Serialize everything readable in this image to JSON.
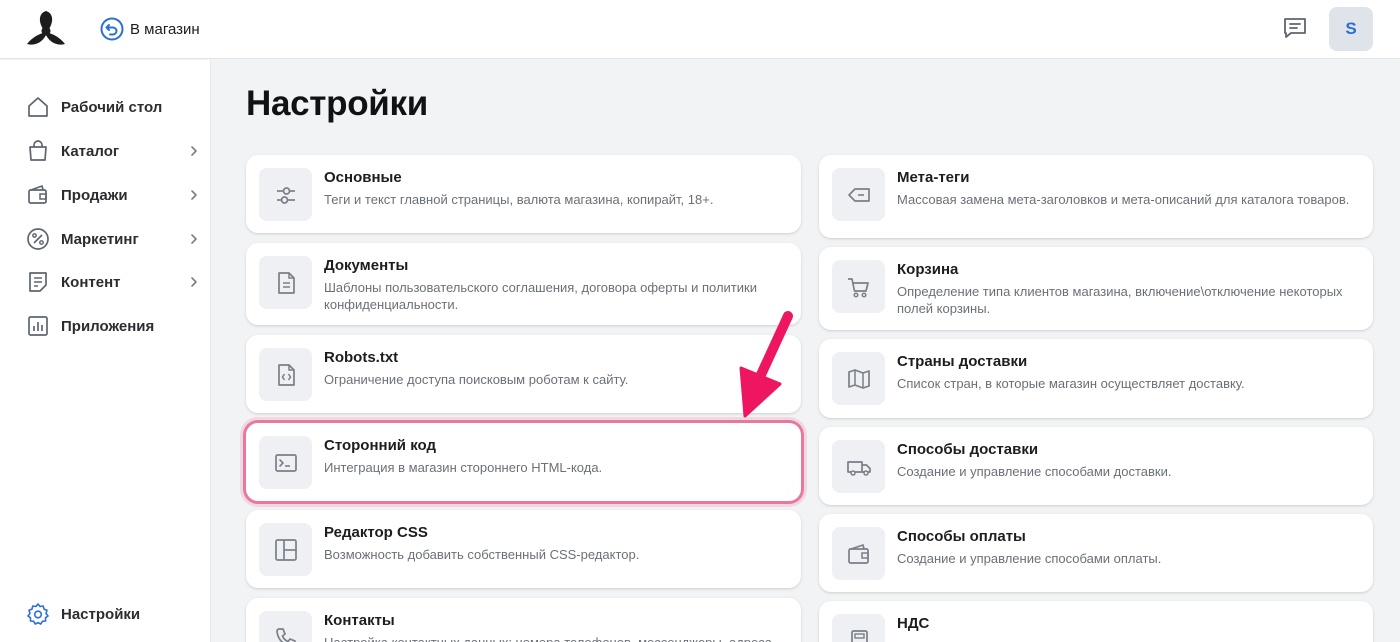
{
  "topbar": {
    "back_label": "В магазин",
    "avatar_letter": "S"
  },
  "sidebar": {
    "items": [
      {
        "label": "Рабочий стол",
        "icon": "home-icon",
        "has_submenu": false
      },
      {
        "label": "Каталог",
        "icon": "bag-icon",
        "has_submenu": true
      },
      {
        "label": "Продажи",
        "icon": "wallet-icon",
        "has_submenu": true
      },
      {
        "label": "Маркетинг",
        "icon": "percent-icon",
        "has_submenu": true
      },
      {
        "label": "Контент",
        "icon": "document-icon",
        "has_submenu": true
      },
      {
        "label": "Приложения",
        "icon": "apps-chart-icon",
        "has_submenu": false
      }
    ],
    "settings_label": "Настройки"
  },
  "main": {
    "title": "Настройки",
    "left_cards": [
      {
        "title": "Основные",
        "desc": "Теги и текст главной страницы, валюта магазина, копирайт, 18+.",
        "icon": "sliders-icon"
      },
      {
        "title": "Документы",
        "desc": "Шаблоны пользовательского соглашения, договора оферты и политики конфиденциальности.",
        "icon": "file-text-icon"
      },
      {
        "title": "Robots.txt",
        "desc": "Ограничение доступа поисковым роботам к сайту.",
        "icon": "file-code-icon"
      },
      {
        "title": "Сторонний код",
        "desc": "Интеграция в магазин стороннего HTML-кода.",
        "icon": "terminal-icon",
        "highlighted": true
      },
      {
        "title": "Редактор CSS",
        "desc": "Возможность добавить собственный CSS-редактор.",
        "icon": "layout-icon"
      },
      {
        "title": "Контакты",
        "desc": "Настройка контактных данных: номера телефонов, мессенджеры, адреса",
        "icon": "phone-icon"
      }
    ],
    "right_cards": [
      {
        "title": "Мета-теги",
        "desc": "Массовая замена мета-заголовков и мета-описаний для каталога товаров.",
        "icon": "tag-icon"
      },
      {
        "title": "Корзина",
        "desc": "Определение типа клиентов магазина, включение\\отключение некоторых полей корзины.",
        "icon": "cart-icon"
      },
      {
        "title": "Страны доставки",
        "desc": "Список стран, в которые магазин осуществляет доставку.",
        "icon": "map-icon"
      },
      {
        "title": "Способы доставки",
        "desc": "Создание и управление способами доставки.",
        "icon": "truck-icon"
      },
      {
        "title": "Способы оплаты",
        "desc": "Создание и управление способами оплаты.",
        "icon": "wallet-icon"
      },
      {
        "title": "НДС",
        "desc": "",
        "icon": "calculator-icon"
      }
    ]
  },
  "colors": {
    "accent": "#2b6fd6",
    "highlight": "#e8799e",
    "arrow": "#ee1660"
  }
}
